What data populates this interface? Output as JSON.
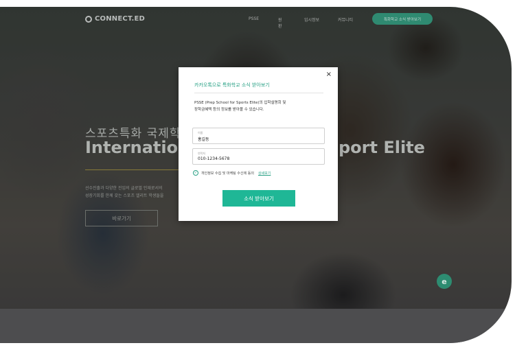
{
  "nav": {
    "logo_text": "CONNECT.ED",
    "items": [
      "PSSE",
      "원환",
      "입시정보",
      "커뮤니티"
    ],
    "cta_label": "특화학교 소식 받아보기"
  },
  "hero": {
    "title_kr": "스포츠특화 국제학교",
    "title_en_left": "Internation",
    "title_en_right": "port Elite",
    "desc_line1": "선수진출과 다양한 진입의 글로벌 인재로서의",
    "desc_line2": "성장기회를 한께 갖는 스포츠 엘리트 학생들을",
    "button_label": "바로가기"
  },
  "modal": {
    "close_symbol": "×",
    "title": "카카오톡으로 특화학교 소식 받아보기",
    "desc_line1": "PSSE (Prep School for Sports Elite)의 입학설명회 및",
    "desc_line2": "장학금혜택 등의 정보를 받아볼 수 있습니다.",
    "name_field": {
      "label": "이름",
      "value": "홍길동"
    },
    "phone_field": {
      "label": "연락처",
      "value": "010-1234-5678"
    },
    "consent_text": "개인정보 수집 및 마케팅 수신에 동의",
    "consent_link": "상세보기",
    "submit_label": "소식 받아보기"
  },
  "icons": {
    "logo": "connected-logo-icon",
    "chat": "chat-bubble-icon",
    "check": "check-circle-icon"
  },
  "colors": {
    "accent": "#1fb796",
    "accent_dark": "#2f8a71"
  }
}
